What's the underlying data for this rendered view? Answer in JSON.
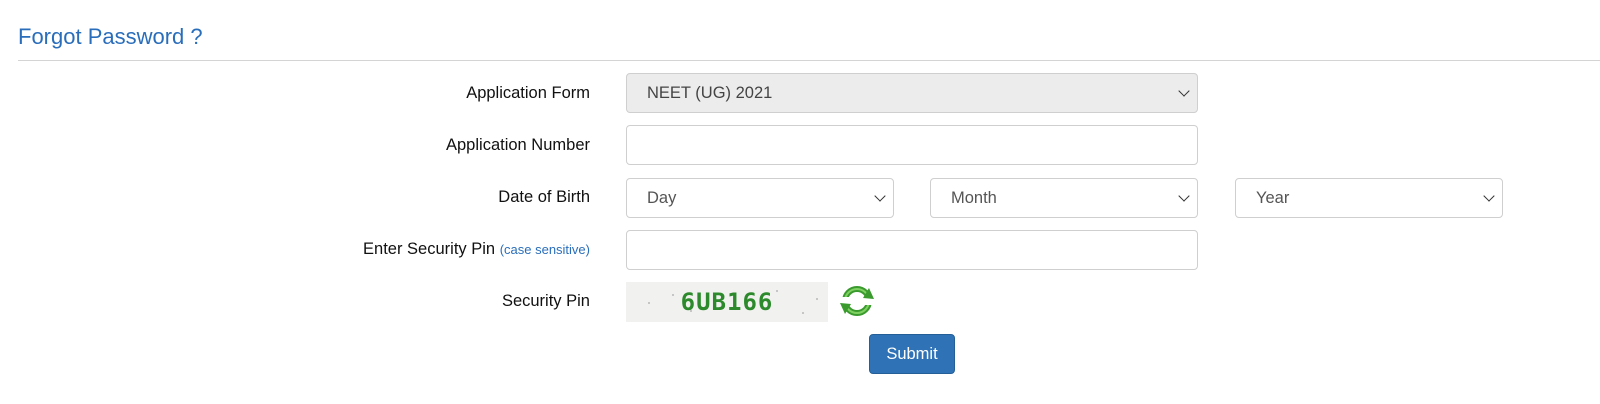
{
  "page": {
    "title": "Forgot Password ?"
  },
  "form": {
    "application_form": {
      "label": "Application Form",
      "value": "NEET (UG) 2021"
    },
    "application_number": {
      "label": "Application Number",
      "value": ""
    },
    "date_of_birth": {
      "label": "Date of Birth",
      "day": "Day",
      "month": "Month",
      "year": "Year"
    },
    "security_pin_input": {
      "label": "Enter Security Pin",
      "hint": "(case sensitive)",
      "value": ""
    },
    "security_pin": {
      "label": "Security Pin",
      "captcha_text": "6UB166"
    },
    "submit_label": "Submit"
  },
  "colors": {
    "title": "#2a6ebb",
    "button": "#2f73b6",
    "captcha_text": "#2c8a2c",
    "refresh_icon": "#3a9a2e"
  }
}
